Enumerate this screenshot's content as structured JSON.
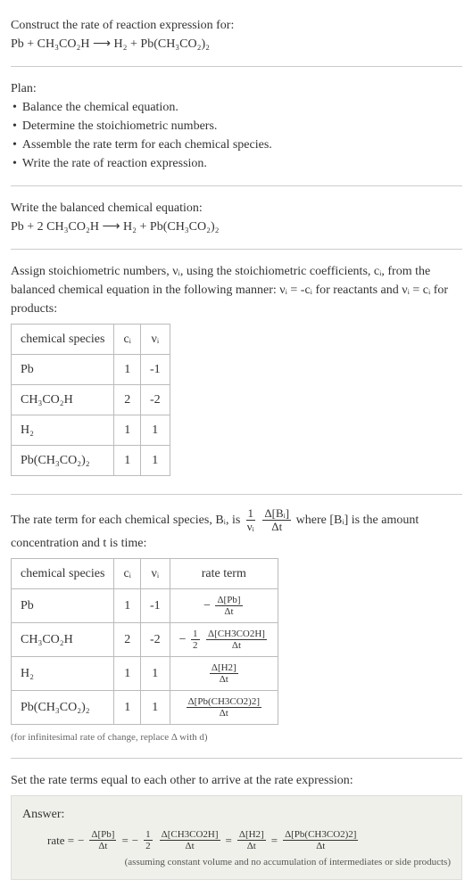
{
  "header": {
    "construct_text": "Construct the rate of reaction expression for:",
    "equation_unbalanced": "Pb + CH₃CO₂H  ⟶  H₂ + Pb(CH₃CO₂)₂"
  },
  "plan": {
    "title": "Plan:",
    "items": [
      "Balance the chemical equation.",
      "Determine the stoichiometric numbers.",
      "Assemble the rate term for each chemical species.",
      "Write the rate of reaction expression."
    ]
  },
  "balanced": {
    "intro": "Write the balanced chemical equation:",
    "equation": "Pb + 2 CH₃CO₂H  ⟶  H₂ + Pb(CH₃CO₂)₂"
  },
  "stoich": {
    "intro_a": "Assign stoichiometric numbers, νᵢ, using the stoichiometric coefficients, cᵢ, from the balanced chemical equation in the following manner: νᵢ = -cᵢ for reactants and νᵢ = cᵢ for products:",
    "headers": {
      "species": "chemical species",
      "ci": "cᵢ",
      "vi": "νᵢ"
    },
    "rows": [
      {
        "species": "Pb",
        "ci": "1",
        "vi": "-1"
      },
      {
        "species": "CH₃CO₂H",
        "ci": "2",
        "vi": "-2"
      },
      {
        "species": "H₂",
        "ci": "1",
        "vi": "1"
      },
      {
        "species": "Pb(CH₃CO₂)₂",
        "ci": "1",
        "vi": "1"
      }
    ]
  },
  "rate_term": {
    "intro_a": "The rate term for each chemical species, Bᵢ, is ",
    "intro_b": " where [Bᵢ] is the amount concentration and t is time:",
    "frac1_num": "1",
    "frac1_den": "νᵢ",
    "frac2_num": "Δ[Bᵢ]",
    "frac2_den": "Δt",
    "headers": {
      "species": "chemical species",
      "ci": "cᵢ",
      "vi": "νᵢ",
      "rate": "rate term"
    },
    "rows": [
      {
        "species": "Pb",
        "ci": "1",
        "vi": "-1",
        "neg": "−",
        "coef_num": "",
        "coef_den": "",
        "num": "Δ[Pb]",
        "den": "Δt"
      },
      {
        "species": "CH₃CO₂H",
        "ci": "2",
        "vi": "-2",
        "neg": "−",
        "coef_num": "1",
        "coef_den": "2",
        "num": "Δ[CH3CO2H]",
        "den": "Δt"
      },
      {
        "species": "H₂",
        "ci": "1",
        "vi": "1",
        "neg": "",
        "coef_num": "",
        "coef_den": "",
        "num": "Δ[H2]",
        "den": "Δt"
      },
      {
        "species": "Pb(CH₃CO₂)₂",
        "ci": "1",
        "vi": "1",
        "neg": "",
        "coef_num": "",
        "coef_den": "",
        "num": "Δ[Pb(CH3CO2)2]",
        "den": "Δt"
      }
    ],
    "note": "(for infinitesimal rate of change, replace Δ with d)"
  },
  "final": {
    "intro": "Set the rate terms equal to each other to arrive at the rate expression:",
    "answer_label": "Answer:",
    "rate_label": "rate =",
    "terms": [
      {
        "neg": "−",
        "coef_num": "",
        "coef_den": "",
        "num": "Δ[Pb]",
        "den": "Δt"
      },
      {
        "neg": "−",
        "coef_num": "1",
        "coef_den": "2",
        "num": "Δ[CH3CO2H]",
        "den": "Δt"
      },
      {
        "neg": "",
        "coef_num": "",
        "coef_den": "",
        "num": "Δ[H2]",
        "den": "Δt"
      },
      {
        "neg": "",
        "coef_num": "",
        "coef_den": "",
        "num": "Δ[Pb(CH3CO2)2]",
        "den": "Δt"
      }
    ],
    "eq": "=",
    "note": "(assuming constant volume and no accumulation of intermediates or side products)"
  }
}
